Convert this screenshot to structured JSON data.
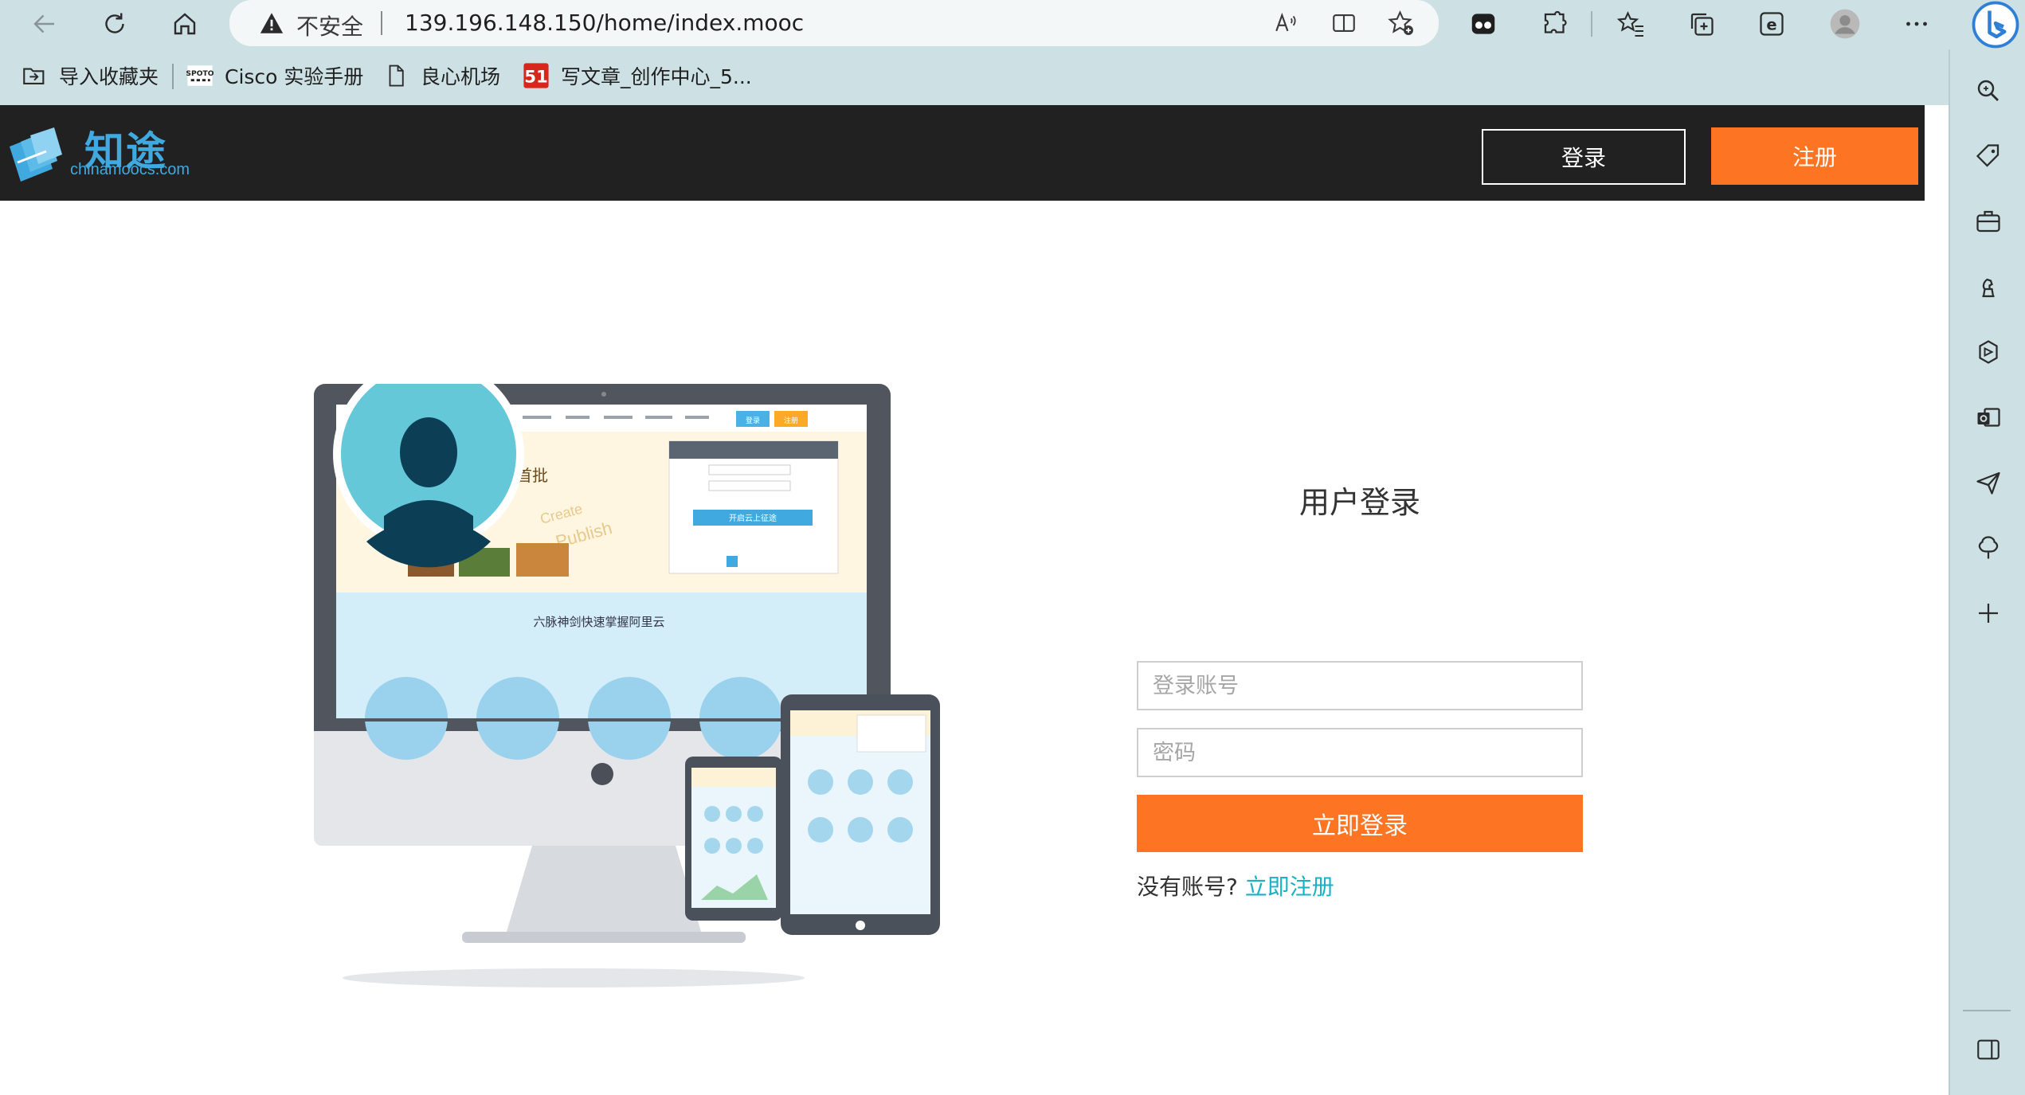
{
  "browser": {
    "insecure_label": "不安全",
    "url": "139.196.148.150/home/index.mooc",
    "bookmarks": [
      {
        "label": "导入收藏夹"
      },
      {
        "label": "Cisco 实验手册"
      },
      {
        "label": "良心机场"
      },
      {
        "label": "写文章_创作中心_5..."
      }
    ],
    "bookmark_badge_spoto": "SPOTO",
    "bookmark_badge_51": "51"
  },
  "site": {
    "logo_cn": "知途",
    "logo_en": "chinamoocs.com",
    "header_login": "登录",
    "header_register": "注册"
  },
  "illustration": {
    "nav_btn_login": "登录",
    "nav_btn_register": "注册",
    "banner_left": "全球首批",
    "banner_create": "Create",
    "banner_publish": "Publish",
    "form_button": "开启云上征途",
    "strip_text": "六脉神剑快速掌握阿里云"
  },
  "login": {
    "title": "用户登录",
    "account_placeholder": "登录账号",
    "password_placeholder": "密码",
    "submit_label": "立即登录",
    "no_account_text": "没有账号?",
    "register_link": "立即注册"
  },
  "colors": {
    "accent_orange": "#fd7423",
    "link_teal": "#1ab1c7",
    "header_bg": "#212121",
    "chrome_bg": "#cde1e5"
  }
}
